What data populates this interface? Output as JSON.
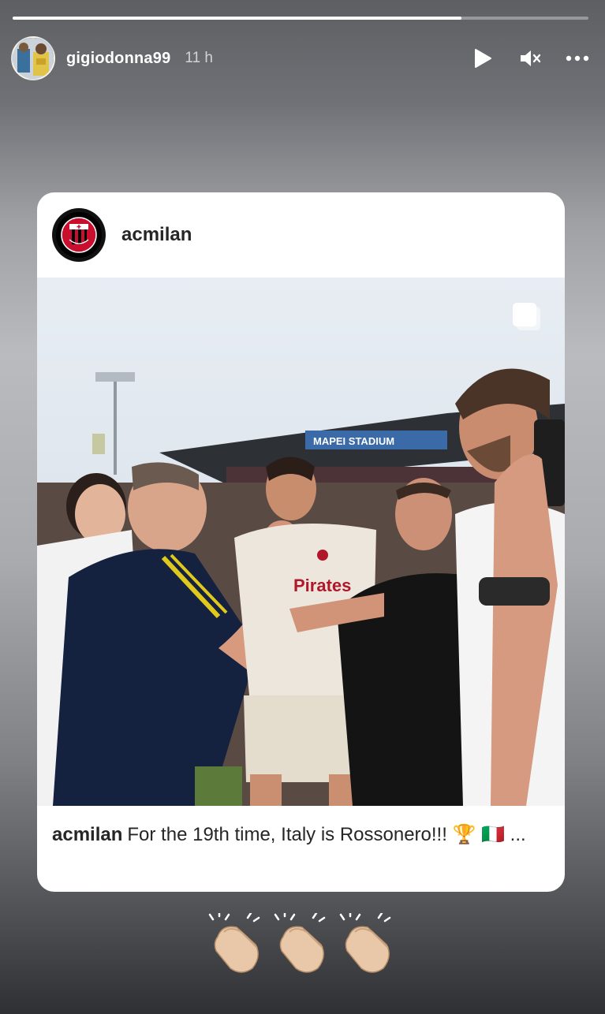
{
  "story": {
    "username": "gigiodonna99",
    "timestamp": "11 h",
    "progress": 0.78
  },
  "post": {
    "author": "acmilan",
    "caption_user": "acmilan",
    "caption_text": "For the 19th time, Italy is Rossonero!!! 🏆 🇮🇹 ...",
    "stadium_banner": "MAPEI STADIUM",
    "jersey_text": "Pirates"
  },
  "icons": {
    "play": "play-icon",
    "mute": "speaker-muted-icon",
    "more": "more-horizontal-icon",
    "multi": "carousel-icon",
    "sticker": "clapping-hands-sticker"
  },
  "colors": {
    "milan_red": "#c8102e",
    "milan_black": "#000000",
    "text_dark": "#262626"
  }
}
